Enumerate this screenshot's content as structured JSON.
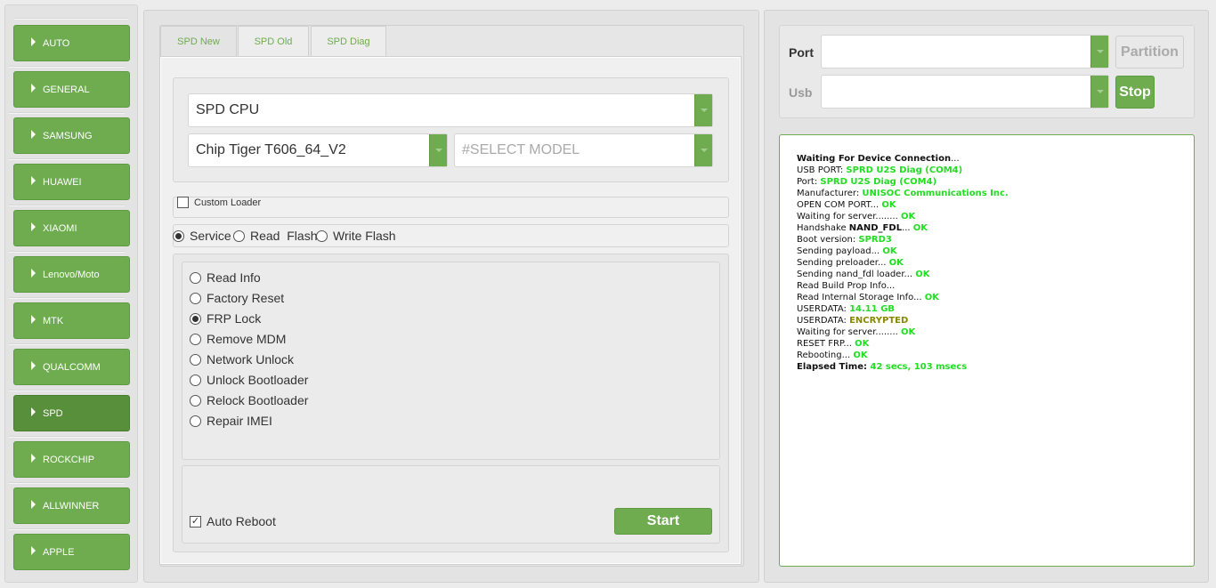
{
  "sidebar": {
    "items": [
      {
        "label": "AUTO"
      },
      {
        "label": "GENERAL"
      },
      {
        "label": "SAMSUNG"
      },
      {
        "label": "HUAWEI"
      },
      {
        "label": "XIAOMI"
      },
      {
        "label": "Lenovo/Moto"
      },
      {
        "label": "MTK"
      },
      {
        "label": "QUALCOMM"
      },
      {
        "label": "SPD"
      },
      {
        "label": "ROCKCHIP"
      },
      {
        "label": "ALLWINNER"
      },
      {
        "label": "APPLE"
      }
    ],
    "active": "SPD"
  },
  "tabs": [
    {
      "label": "SPD New"
    },
    {
      "label": "SPD Old"
    },
    {
      "label": "SPD Diag"
    }
  ],
  "cpu_select": {
    "value": "SPD CPU"
  },
  "chip_select": {
    "value": "Chip Tiger T606_64_V2"
  },
  "model_select": {
    "placeholder": "#SELECT MODEL"
  },
  "custom_loader": {
    "label": "Custom Loader",
    "checked": false
  },
  "mode": {
    "options": [
      {
        "label": "Service",
        "selected": true
      },
      {
        "label": "Read  Flash",
        "selected": false
      },
      {
        "label": "Write Flash",
        "selected": false
      }
    ]
  },
  "operations": [
    {
      "label": "Read Info",
      "selected": false
    },
    {
      "label": "Factory Reset",
      "selected": false
    },
    {
      "label": "FRP Lock",
      "selected": true
    },
    {
      "label": "Remove MDM",
      "selected": false
    },
    {
      "label": "Network Unlock",
      "selected": false
    },
    {
      "label": "Unlock Bootloader",
      "selected": false
    },
    {
      "label": "Relock Bootloader",
      "selected": false
    },
    {
      "label": "Repair IMEI",
      "selected": false
    }
  ],
  "auto_reboot": {
    "label": "Auto Reboot",
    "checked": true
  },
  "start_button": {
    "label": "Start"
  },
  "port": {
    "label": "Port",
    "value": ""
  },
  "usb": {
    "label": "Usb",
    "value": ""
  },
  "partition_button": {
    "label": "Partition"
  },
  "stop_button": {
    "label": "Stop"
  },
  "colors": {
    "accent": "#6eac4f",
    "ok": "#22dd22",
    "encrypted": "#888800"
  },
  "log": [
    [
      {
        "t": "Waiting For Device Connection",
        "s": "b"
      },
      {
        "t": "...",
        "s": ""
      }
    ],
    [
      {
        "t": "USB PORT: ",
        "s": ""
      },
      {
        "t": "SPRD U2S Diag (COM4)",
        "s": "g"
      }
    ],
    [
      {
        "t": "Port: ",
        "s": ""
      },
      {
        "t": "SPRD U2S Diag (COM4)",
        "s": "g"
      }
    ],
    [
      {
        "t": "Manufacturer: ",
        "s": ""
      },
      {
        "t": "UNISOC Communications Inc.",
        "s": "g"
      }
    ],
    [
      {
        "t": "OPEN COM PORT... ",
        "s": ""
      },
      {
        "t": "OK",
        "s": "g"
      }
    ],
    [
      {
        "t": "Waiting for server........ ",
        "s": ""
      },
      {
        "t": "OK",
        "s": "g"
      }
    ],
    [
      {
        "t": "Handshake ",
        "s": ""
      },
      {
        "t": "NAND_FDL",
        "s": "b"
      },
      {
        "t": "... ",
        "s": ""
      },
      {
        "t": "OK",
        "s": "g"
      }
    ],
    [
      {
        "t": "Boot version: ",
        "s": ""
      },
      {
        "t": "SPRD3",
        "s": "g"
      }
    ],
    [
      {
        "t": "Sending payload... ",
        "s": ""
      },
      {
        "t": "OK",
        "s": "g"
      }
    ],
    [
      {
        "t": "Sending preloader... ",
        "s": ""
      },
      {
        "t": "OK",
        "s": "g"
      }
    ],
    [
      {
        "t": "Sending nand_fdl loader... ",
        "s": ""
      },
      {
        "t": "OK",
        "s": "g"
      }
    ],
    [
      {
        "t": "Read Build Prop Info...",
        "s": ""
      }
    ],
    [
      {
        "t": "Read Internal Storage Info... ",
        "s": ""
      },
      {
        "t": "OK",
        "s": "g"
      }
    ],
    [
      {
        "t": "USERDATA: ",
        "s": ""
      },
      {
        "t": "14.11 GB",
        "s": "g"
      }
    ],
    [
      {
        "t": "USERDATA: ",
        "s": ""
      },
      {
        "t": "ENCRYPTED",
        "s": "o"
      }
    ],
    [
      {
        "t": "Waiting for server........ ",
        "s": ""
      },
      {
        "t": "OK",
        "s": "g"
      }
    ],
    [
      {
        "t": "RESET FRP... ",
        "s": ""
      },
      {
        "t": "OK",
        "s": "g"
      }
    ],
    [
      {
        "t": "Rebooting... ",
        "s": ""
      },
      {
        "t": "OK",
        "s": "g"
      }
    ],
    [
      {
        "t": "Elapsed Time: ",
        "s": "b"
      },
      {
        "t": "42 secs, 103 msecs",
        "s": "g"
      }
    ]
  ]
}
